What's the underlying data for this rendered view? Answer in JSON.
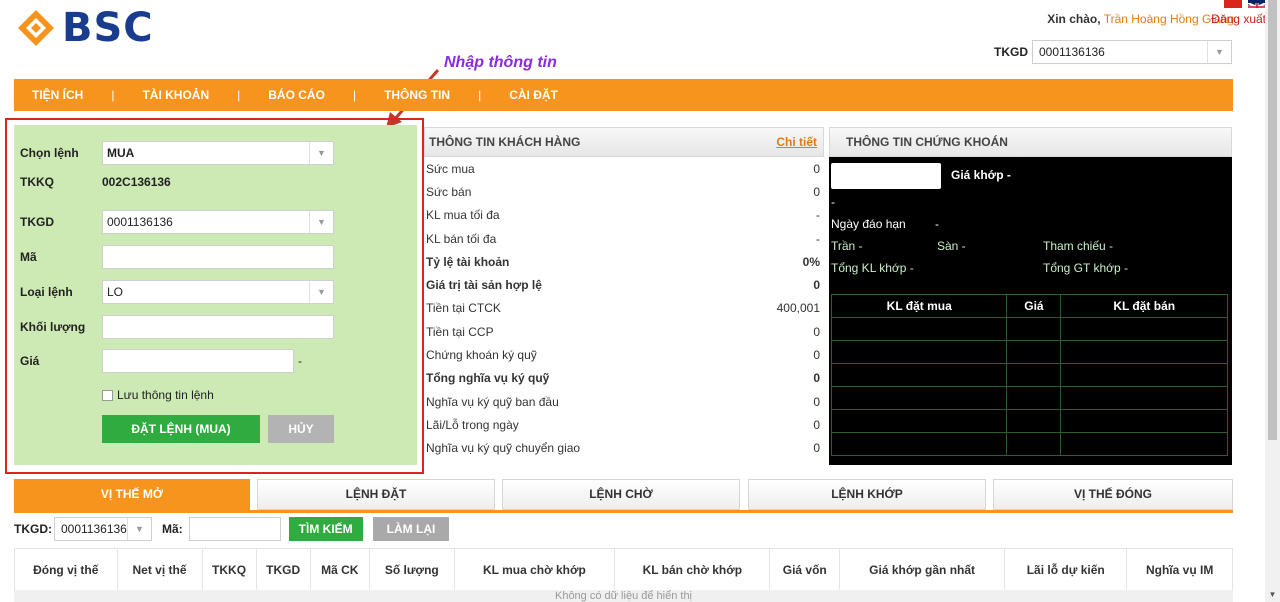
{
  "header": {
    "brand": "BSC",
    "greeting": "Xin chào,",
    "user_name": "Trần Hoàng Hồng Giang",
    "logout": "Đăng xuất",
    "tkgd_label": "TKGD",
    "tkgd_value": "0001136136"
  },
  "annotation": "Nhập thông tin",
  "nav": [
    "TIỆN ÍCH",
    "TÀI KHOẢN",
    "BÁO CÁO",
    "THÔNG TIN",
    "CÀI ĐẶT"
  ],
  "nav_sep": "|",
  "order_form": {
    "chon_lenh_label": "Chọn lệnh",
    "chon_lenh_value": "MUA",
    "tkkq_label": "TKKQ",
    "tkkq_value": "002C136136",
    "tkgd_label": "TKGD",
    "tkgd_value": "0001136136",
    "ma_label": "Mã",
    "loai_lenh_label": "Loại lệnh",
    "loai_lenh_value": "LO",
    "khoi_luong_label": "Khối lượng",
    "gia_label": "Giá",
    "gia_suffix": "-",
    "save_label": "Lưu thông tin lệnh",
    "submit_label": "ĐẶT LỆNH (MUA)",
    "cancel_label": "HỦY"
  },
  "customer": {
    "title": "THÔNG TIN KHÁCH HÀNG",
    "detail": "Chi tiết",
    "rows": [
      {
        "label": "Sức mua",
        "value": "0",
        "bold": false
      },
      {
        "label": "Sức bán",
        "value": "0",
        "bold": false
      },
      {
        "label": "KL mua tối đa",
        "value": "-",
        "bold": false
      },
      {
        "label": "KL bán tối đa",
        "value": "-",
        "bold": false
      },
      {
        "label": "Tỷ lệ tài khoản",
        "value": "0%",
        "bold": true
      },
      {
        "label": "Giá trị tài sản hợp lệ",
        "value": "0",
        "bold": true
      },
      {
        "label": "Tiền tại CTCK",
        "value": "400,001",
        "bold": false
      },
      {
        "label": "Tiền tại CCP",
        "value": "0",
        "bold": false
      },
      {
        "label": "Chứng khoán ký quỹ",
        "value": "0",
        "bold": false
      },
      {
        "label": "Tổng nghĩa vụ ký quỹ",
        "value": "0",
        "bold": true
      },
      {
        "label": "Nghĩa vụ ký quỹ ban đầu",
        "value": "0",
        "bold": false
      },
      {
        "label": "Lãi/Lỗ trong ngày",
        "value": "0",
        "bold": false
      },
      {
        "label": "Nghĩa vụ ký quỹ chuyển giao",
        "value": "0",
        "bold": false
      }
    ]
  },
  "securities": {
    "title": "THÔNG TIN CHỨNG KHOÁN",
    "gia_khop": "Giá khớp -",
    "dash": "-",
    "ngay_dao_han": "Ngày đáo hạn",
    "ngay_dao_han_val": "-",
    "tran": "Trần -",
    "san": "Sàn -",
    "tham_chieu": "Tham chiếu -",
    "tong_kl_khop": "Tổng KL khớp -",
    "tong_gt_khop": "Tổng GT khớp -",
    "columns": [
      "KL đặt mua",
      "Giá",
      "KL đặt bán"
    ]
  },
  "tabs": [
    "VỊ THẾ MỞ",
    "LỆNH ĐẶT",
    "LỆNH CHỜ",
    "LỆNH KHỚP",
    "VỊ THẾ ĐÓNG"
  ],
  "search": {
    "tkgd_label": "TKGD:",
    "tkgd_value": "0001136136",
    "ma_label": "Mã:",
    "search_btn": "TÌM KIẾM",
    "reset_btn": "LÀM LẠI"
  },
  "table": {
    "columns": [
      "Đóng vị thế",
      "Net vị thế",
      "TKKQ",
      "TKGD",
      "Mã CK",
      "Số lượng",
      "KL mua chờ khớp",
      "KL bán chờ khớp",
      "Giá vốn",
      "Giá khớp gần nhất",
      "Lãi lỗ dự kiến",
      "Nghĩa vụ IM"
    ],
    "empty": "Không có dữ liệu để hiển thị"
  },
  "colors": {
    "accent": "#f7941d",
    "form_bg": "#cde9b4",
    "brand": "#1a3c8f",
    "highlight": "#d9251d"
  }
}
